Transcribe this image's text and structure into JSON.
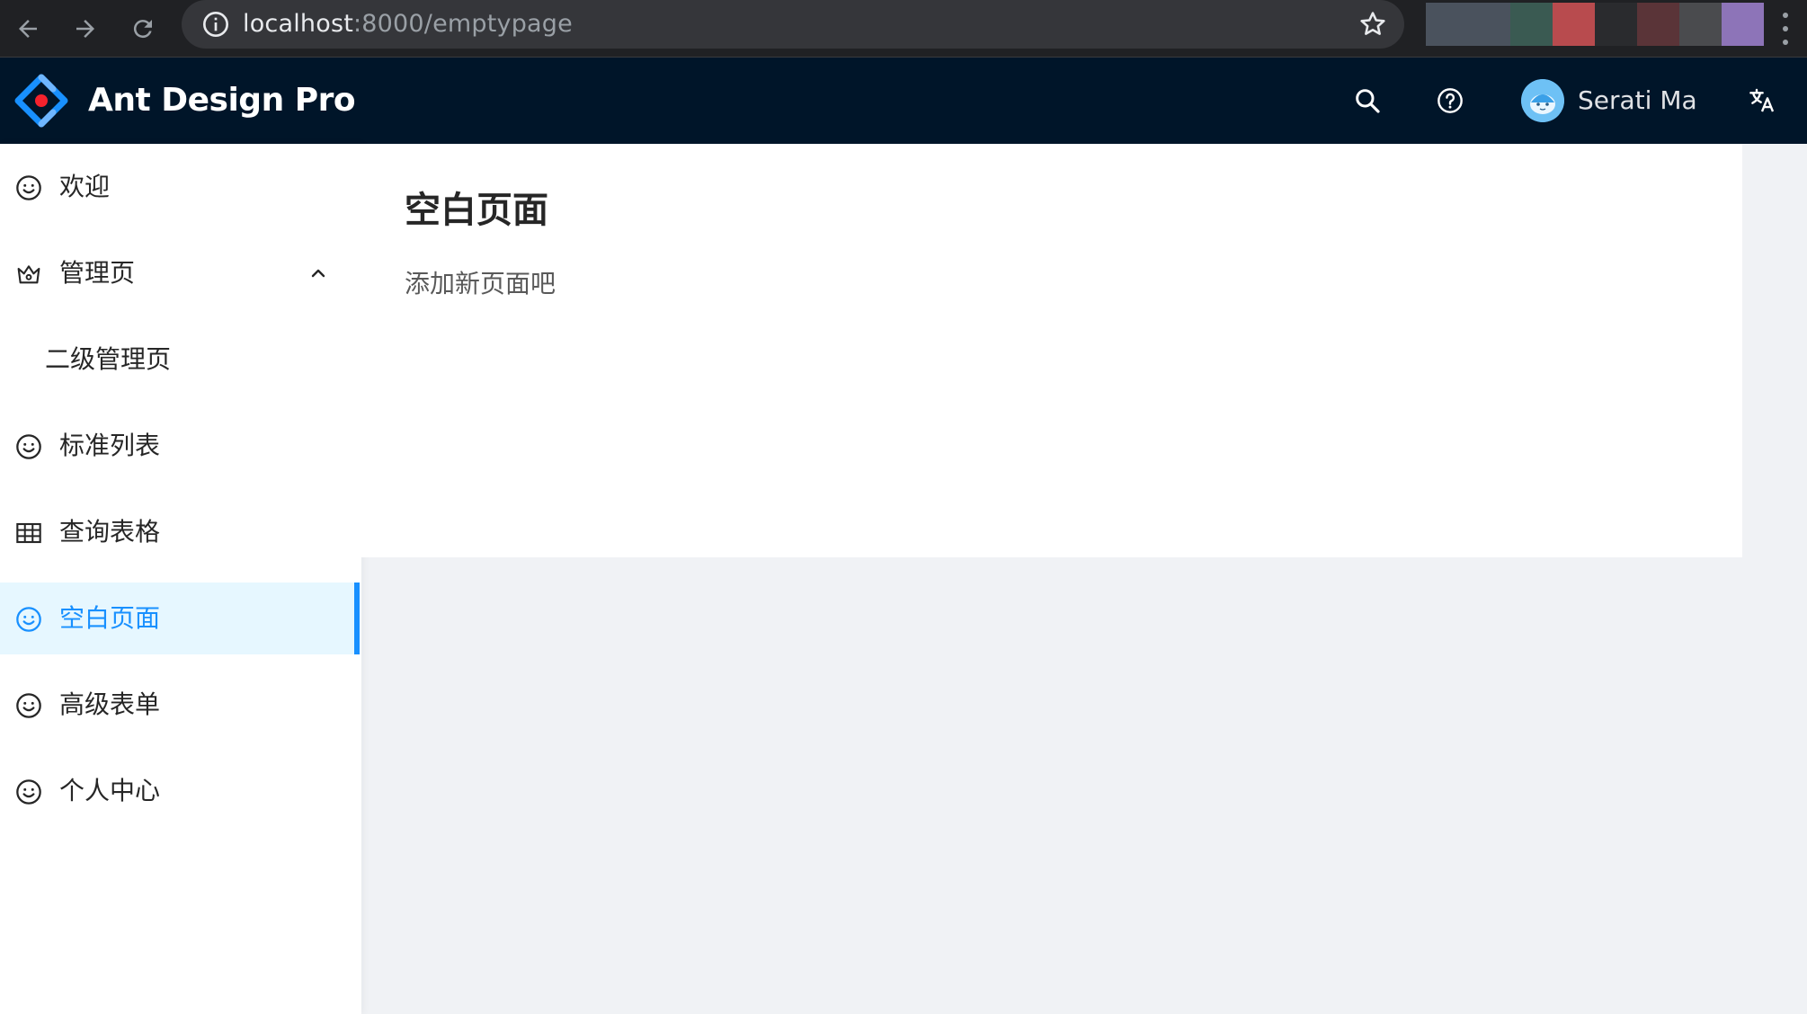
{
  "browser": {
    "url_host": "localhost",
    "url_path": ":8000/emptypage",
    "extension_colors": [
      "#4a525d",
      "#4a525d",
      "#3a5a52",
      "#b84b4e",
      "#2a2b2e",
      "#5a3438",
      "#4a4b4e",
      "#8d74b8"
    ]
  },
  "header": {
    "title": "Ant Design Pro",
    "user_name": "Serati Ma",
    "background_color": "#001529"
  },
  "sidebar": {
    "items": [
      {
        "label": "欢迎",
        "icon": "smile-icon"
      },
      {
        "label": "管理页",
        "icon": "crown-icon"
      },
      {
        "label": "二级管理页"
      },
      {
        "label": "标准列表",
        "icon": "smile-icon"
      },
      {
        "label": "查询表格",
        "icon": "table-icon"
      },
      {
        "label": "空白页面",
        "icon": "smile-icon",
        "selected": true
      },
      {
        "label": "高级表单",
        "icon": "smile-icon"
      },
      {
        "label": "个人中心",
        "icon": "smile-icon"
      }
    ],
    "accent_color": "#1890ff"
  },
  "content": {
    "title": "空白页面",
    "description": "添加新页面吧"
  }
}
